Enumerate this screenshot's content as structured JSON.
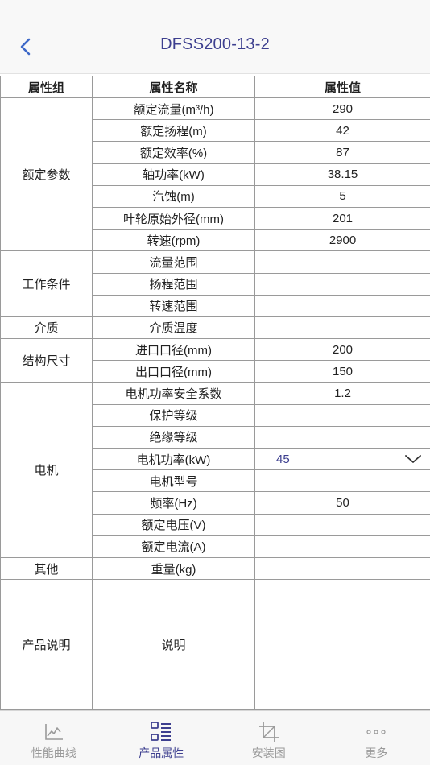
{
  "header": {
    "title": "DFSS200-13-2",
    "back_icon": "chevron-left-icon"
  },
  "colors": {
    "accent": "#3d3f8f",
    "border": "#9a9a9a",
    "inactive": "#9a9a9a"
  },
  "table": {
    "headers": [
      "属性组",
      "属性名称",
      "属性值"
    ],
    "groups": {
      "rated": "额定参数",
      "working": "工作条件",
      "medium": "介质",
      "structure": "结构尺寸",
      "motor": "电机",
      "other": "其他",
      "description": "产品说明"
    },
    "rows": [
      {
        "name": "额定流量(m³/h)",
        "value": "290"
      },
      {
        "name": "额定扬程(m)",
        "value": "42"
      },
      {
        "name": "额定效率(%)",
        "value": "87"
      },
      {
        "name": "轴功率(kW)",
        "value": "38.15"
      },
      {
        "name": "汽蚀(m)",
        "value": "5"
      },
      {
        "name": "叶轮原始外径(mm)",
        "value": "201"
      },
      {
        "name": "转速(rpm)",
        "value": "2900"
      },
      {
        "name": "流量范围",
        "value": ""
      },
      {
        "name": "扬程范围",
        "value": ""
      },
      {
        "name": "转速范围",
        "value": ""
      },
      {
        "name": "介质温度",
        "value": ""
      },
      {
        "name": "进口口径(mm)",
        "value": "200"
      },
      {
        "name": "出口口径(mm)",
        "value": "150"
      },
      {
        "name": "电机功率安全系数",
        "value": "1.2"
      },
      {
        "name": "保护等级",
        "value": ""
      },
      {
        "name": "绝缘等级",
        "value": ""
      },
      {
        "name": "电机功率(kW)",
        "value": "45"
      },
      {
        "name": "电机型号",
        "value": ""
      },
      {
        "name": "频率(Hz)",
        "value": "50"
      },
      {
        "name": "额定电压(V)",
        "value": ""
      },
      {
        "name": "额定电流(A)",
        "value": ""
      },
      {
        "name": "重量(kg)",
        "value": ""
      },
      {
        "name": "说明",
        "value": ""
      }
    ]
  },
  "tabs": [
    {
      "label": "性能曲线",
      "icon": "line-chart-icon",
      "active": false
    },
    {
      "label": "产品属性",
      "icon": "list-icon",
      "active": true
    },
    {
      "label": "安装图",
      "icon": "crop-icon",
      "active": false
    },
    {
      "label": "更多",
      "icon": "more-dots-icon",
      "active": false
    }
  ]
}
